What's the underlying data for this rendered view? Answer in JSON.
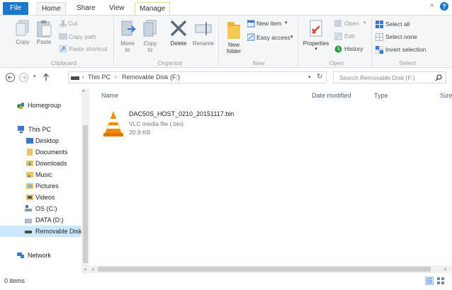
{
  "tabs": {
    "file": "File",
    "home": "Home",
    "share": "Share",
    "view": "View",
    "manage": "Manage"
  },
  "window_controls": {
    "collapse": "^",
    "help": "?"
  },
  "ribbon": {
    "clipboard": {
      "copy": "Copy",
      "paste": "Paste",
      "cut": "Cut",
      "copy_path": "Copy path",
      "paste_shortcut": "Paste shortcut",
      "label": "Clipboard"
    },
    "organize": {
      "move_to": "Move to",
      "copy_to": "Copy to",
      "delete": "Delete",
      "rename": "Rename",
      "label": "Organize"
    },
    "new": {
      "new_folder": "New folder",
      "new_item": "New item",
      "easy_access": "Easy access",
      "label": "New"
    },
    "open": {
      "properties": "Properties",
      "open": "Open",
      "edit": "Edit",
      "history": "History",
      "label": "Open"
    },
    "select": {
      "select_all": "Select all",
      "select_none": "Select none",
      "invert_selection": "Invert selection",
      "label": "Select"
    }
  },
  "address": {
    "crumbs": [
      "This PC",
      "Removable Disk (F:)"
    ],
    "search_placeholder": "Search Removable Disk (F:)"
  },
  "nav": {
    "homegroup": "Homegroup",
    "this_pc": "This PC",
    "items": [
      "Desktop",
      "Documents",
      "Downloads",
      "Music",
      "Pictures",
      "Videos",
      "OS (C:)",
      "DATA (D:)",
      "Removable Disk"
    ],
    "network": "Network"
  },
  "columns": {
    "name": "Name",
    "date_modified": "Date modified",
    "type": "Type",
    "size": "Size"
  },
  "file": {
    "name": "DAC50S_HOST_0210_20151117.bin",
    "type": "VLC media file (.bin)",
    "size": "20.9 KB"
  },
  "status": {
    "items": "0 items"
  },
  "colors": {
    "file_tab": "#1979ca",
    "selected_nav": "#cce8ff",
    "vlc_orange": "#f08a00"
  }
}
